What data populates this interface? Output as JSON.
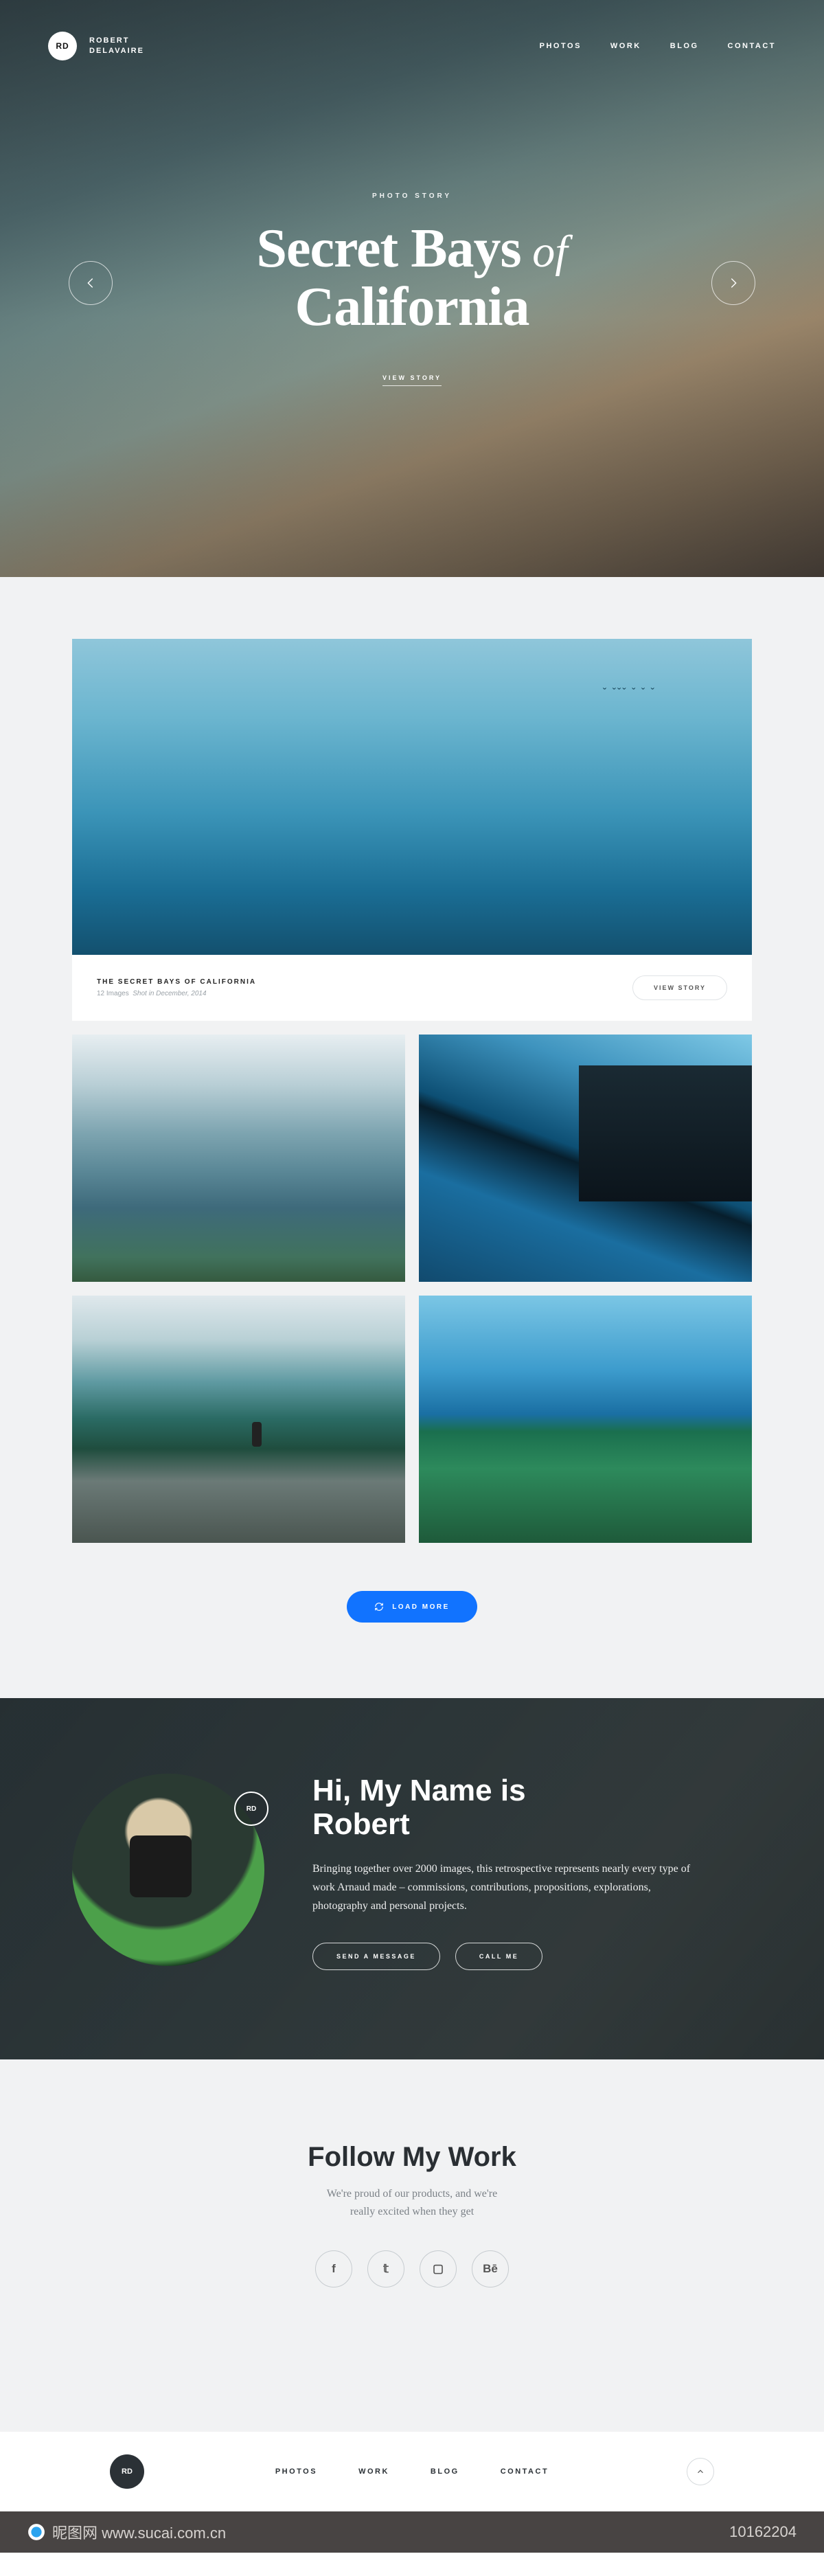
{
  "brand": {
    "initials": "RD",
    "line1": "ROBERT",
    "line2": "DELAVAIRE"
  },
  "nav": {
    "photos": "PHOTOS",
    "work": "WORK",
    "blog": "BLOG",
    "contact": "CONTACT"
  },
  "hero": {
    "eyebrow": "PHOTO STORY",
    "line1a": "Secret Bays",
    "of": " of",
    "line2": "California",
    "cta": "VIEW STORY"
  },
  "feature": {
    "title": "THE SECRET BAYS OF CALIFORNIA",
    "count": "12 Images",
    "date": "Shot in December, 2014",
    "cta": "VIEW STORY"
  },
  "loadMore": "LOAD MORE",
  "about": {
    "badge": "RD",
    "title1": "Hi, My Name is",
    "title2": "Robert",
    "body": "Bringing together over 2000 images, this retrospective represents nearly every type of work Arnaud made – commissions, contributions, propositions, explorations, photography and personal projects.",
    "btn1": "SEND A MESSAGE",
    "btn2": "CALL ME"
  },
  "follow": {
    "title": "Follow My Work",
    "sub1": "We're proud of our products, and we're",
    "sub2": "really excited when they get",
    "fb": "f",
    "tw": "𝕥",
    "ig": "▢",
    "be": "Bē"
  },
  "footLogo": "RD",
  "source": {
    "site": "昵图网 www.sucai.com.cn",
    "id": "10162204"
  }
}
